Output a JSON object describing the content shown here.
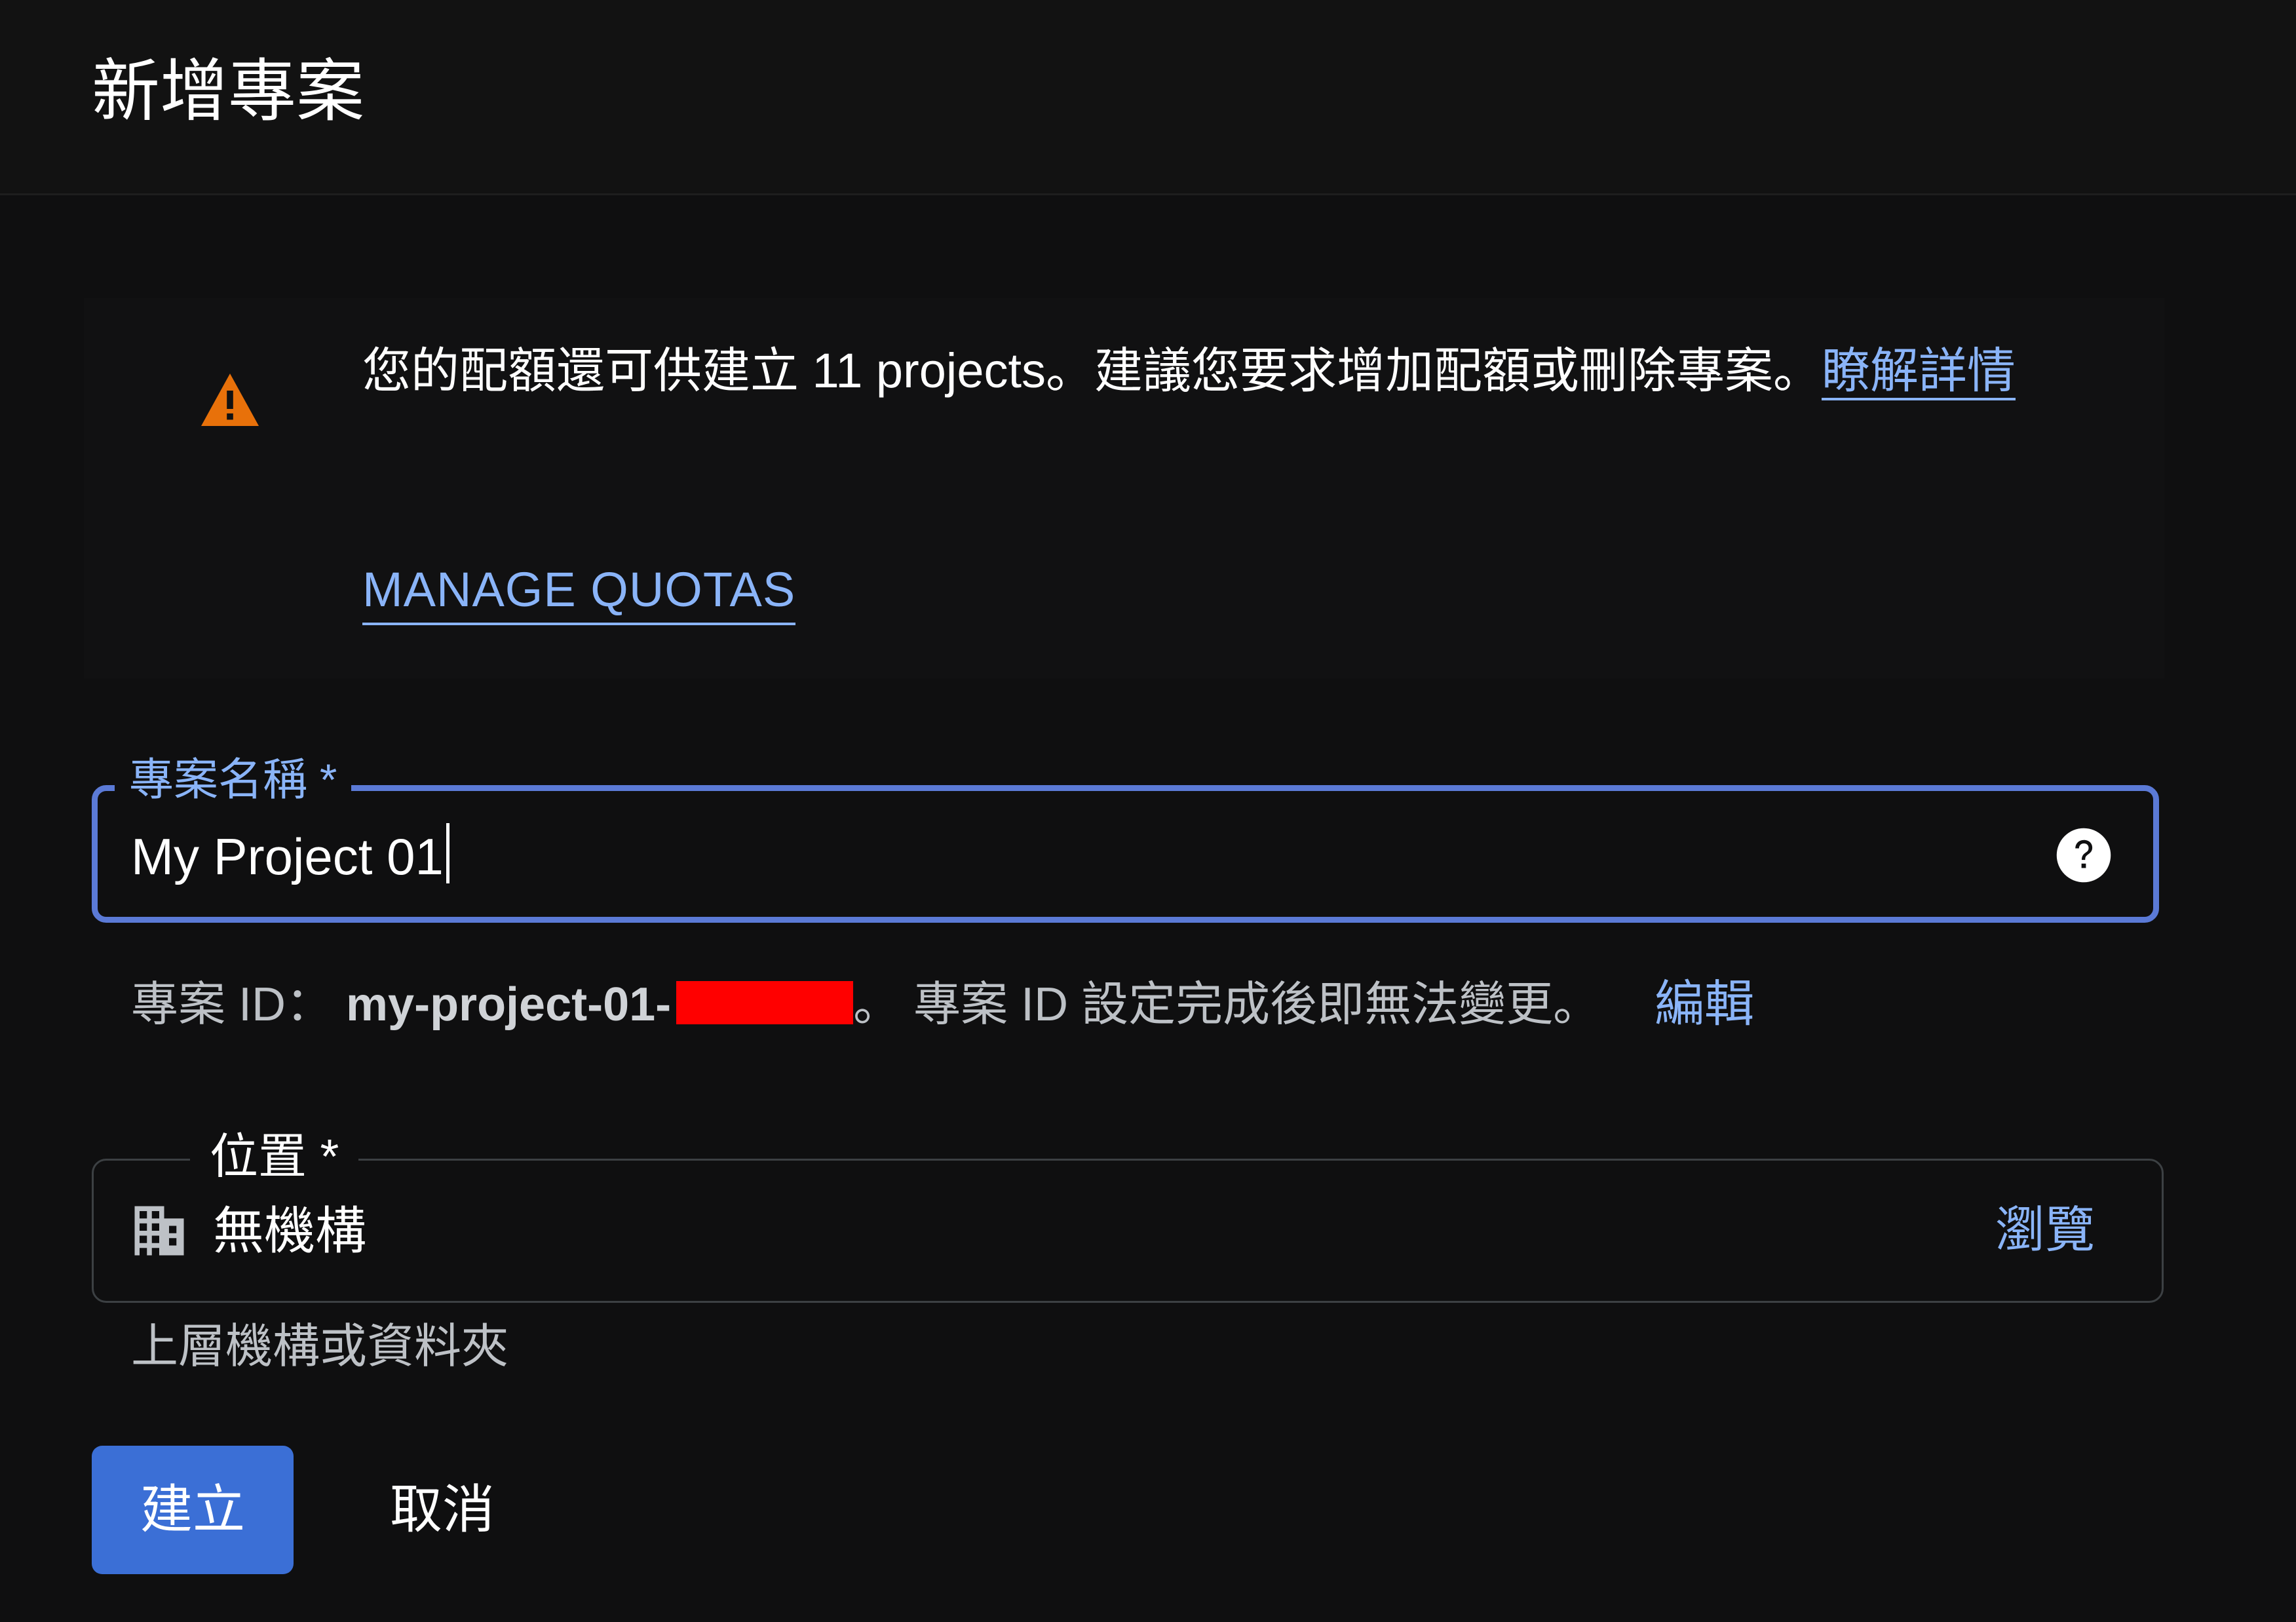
{
  "header": {
    "title": "新增專案"
  },
  "warning_banner": {
    "icon": "warning-icon",
    "message": "您的配額還可供建立 11 projects。建議您要求增加配額或刪除專案。",
    "learn_more_link": "瞭解詳情",
    "manage_quotas_button": "MANAGE QUOTAS",
    "colors": {
      "icon": "#e8710a",
      "link": "#8ab4f8"
    }
  },
  "project_name_field": {
    "label": "專案名稱 *",
    "value": "My Project 01",
    "help_icon": "help-circle-icon",
    "focus_color": "#5b7ad6"
  },
  "project_id": {
    "prefix": "專案 ID：",
    "value": "my-project-01-",
    "suffix": "。 專案 ID 設定完成後即無法變更。",
    "edit_link": "編輯"
  },
  "location_field": {
    "label": "位置 *",
    "icon": "building-icon",
    "value": "無機構",
    "browse_link": "瀏覽",
    "helper_text": "上層機構或資料夾"
  },
  "actions": {
    "create_button": "建立",
    "cancel_button": "取消",
    "primary_color": "#3b6fd6"
  }
}
